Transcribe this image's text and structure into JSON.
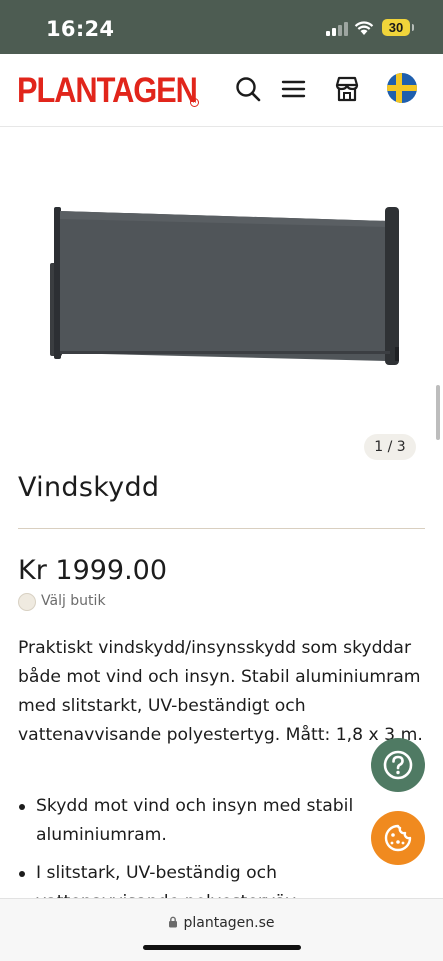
{
  "status": {
    "time": "16:24",
    "battery": "30"
  },
  "header": {
    "logo": "PLANTAGEN",
    "icons": [
      "search-icon",
      "menu-icon",
      "store-icon",
      "sweden-flag-icon"
    ]
  },
  "gallery": {
    "counter": "1 / 3"
  },
  "product": {
    "title": "Vindskydd",
    "price": "Kr 1999.00",
    "store_label": "Välj butik",
    "description": "Praktiskt vindskydd/insynsskydd som skyddar både mot vind och insyn. Stabil aluminiumram med slitstarkt, UV-beständigt och vattenavvisande polyestertyg. Mått: 1,8 x 3 m.",
    "bullets": [
      "Skydd mot vind och insyn med stabil aluminiumram.",
      "I slitstark, UV-beständig och vattenavvisande polyesterväv"
    ]
  },
  "browser": {
    "url": "plantagen.se"
  },
  "colors": {
    "brand_red": "#e1251b",
    "status_bar": "#4d5c52",
    "help_button": "#4f7a63",
    "cookie_button": "#f08a1f"
  }
}
